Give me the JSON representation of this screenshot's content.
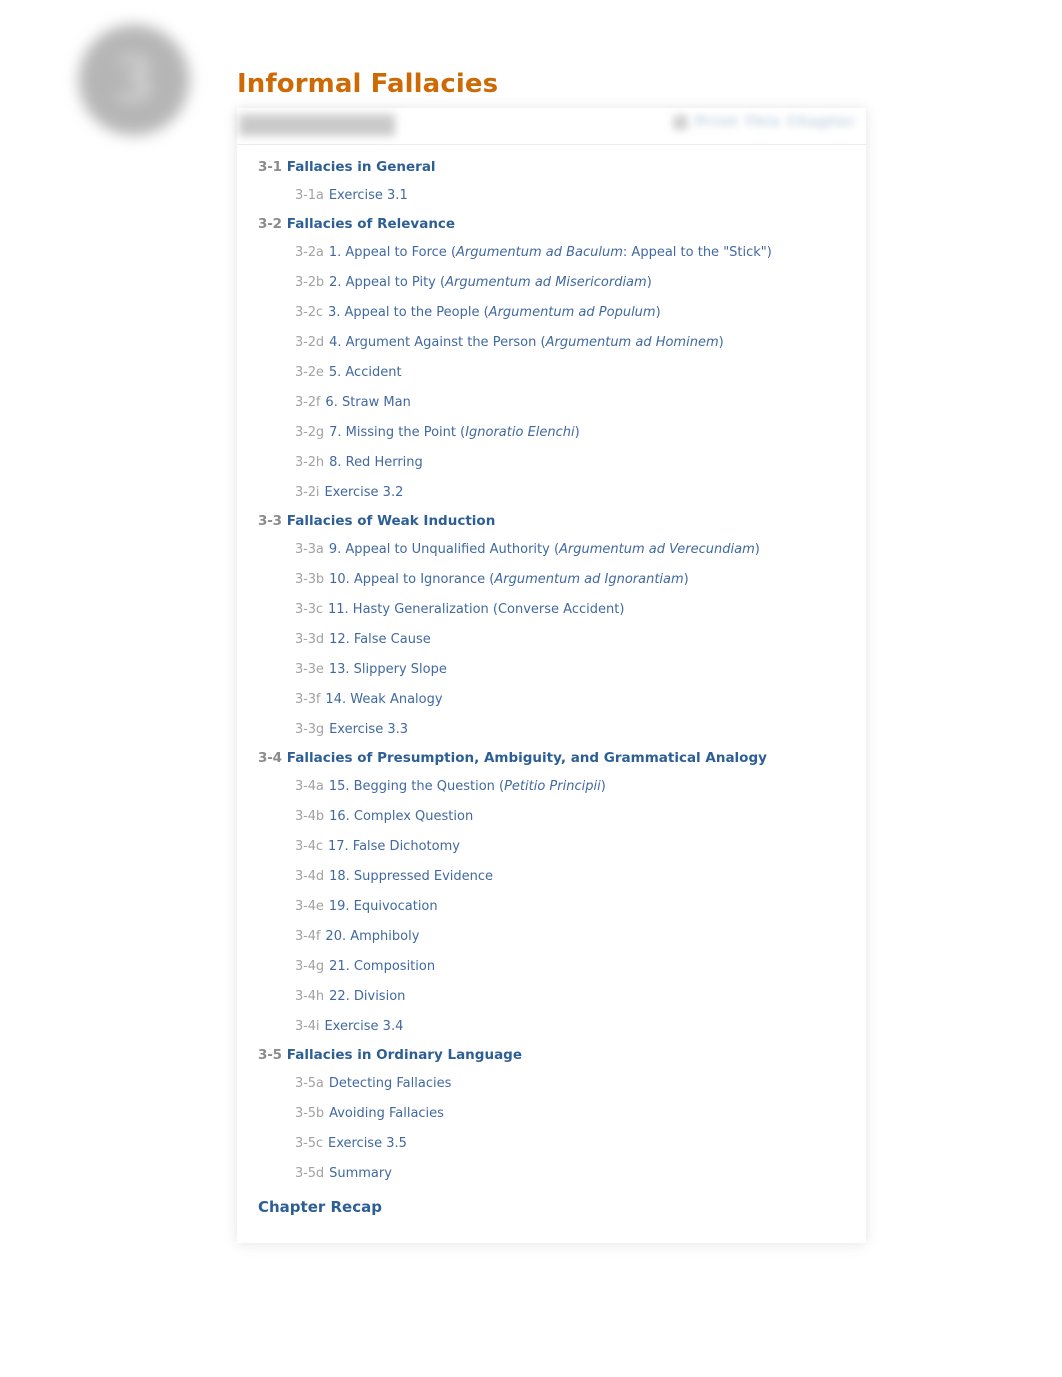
{
  "chapter": {
    "badge_number": "3",
    "title": "Informal Fallacies",
    "title_color": "#cd6a06"
  },
  "toc_header": {
    "tab_label": "Chapter Contents",
    "action_icon": "printer-icon",
    "action_label": "Print This Chapter",
    "blurred": true
  },
  "colors": {
    "section_number": "#8c8c8c",
    "section_title": "#2e5f94",
    "item_number": "#a2a2a2",
    "item_title": "#41699f",
    "accent_orange": "#cd6a06"
  },
  "contents": {
    "sections": [
      {
        "number": "3-1",
        "title": "Fallacies in General",
        "items": [
          {
            "number": "3-1a",
            "title": "Exercise 3.1"
          }
        ]
      },
      {
        "number": "3-2",
        "title": "Fallacies of Relevance",
        "items": [
          {
            "number": "3-2a",
            "title": "1. Appeal to Force (",
            "italic": "Argumentum ad Baculum",
            "title_after": ": Appeal to the \"Stick\")"
          },
          {
            "number": "3-2b",
            "title": "2. Appeal to Pity (",
            "italic": "Argumentum ad Misericordiam",
            "title_after": ")"
          },
          {
            "number": "3-2c",
            "title": "3. Appeal to the People (",
            "italic": "Argumentum ad Populum",
            "title_after": ")"
          },
          {
            "number": "3-2d",
            "title": "4. Argument Against the Person (",
            "italic": "Argumentum ad Hominem",
            "title_after": ")"
          },
          {
            "number": "3-2e",
            "title": "5. Accident"
          },
          {
            "number": "3-2f",
            "title": "6. Straw Man"
          },
          {
            "number": "3-2g",
            "title": "7. Missing the Point (",
            "italic": "Ignoratio Elenchi",
            "title_after": ")"
          },
          {
            "number": "3-2h",
            "title": "8. Red Herring"
          },
          {
            "number": "3-2i",
            "title": "Exercise 3.2"
          }
        ]
      },
      {
        "number": "3-3",
        "title": "Fallacies of Weak Induction",
        "items": [
          {
            "number": "3-3a",
            "title": "9. Appeal to Unqualified Authority (",
            "italic": "Argumentum ad Verecundiam",
            "title_after": ")"
          },
          {
            "number": "3-3b",
            "title": "10. Appeal to Ignorance (",
            "italic": "Argumentum ad Ignorantiam",
            "title_after": ")"
          },
          {
            "number": "3-3c",
            "title": "11. Hasty Generalization (Converse Accident)"
          },
          {
            "number": "3-3d",
            "title": "12. False Cause"
          },
          {
            "number": "3-3e",
            "title": "13. Slippery Slope"
          },
          {
            "number": "3-3f",
            "title": "14. Weak Analogy"
          },
          {
            "number": "3-3g",
            "title": "Exercise 3.3"
          }
        ]
      },
      {
        "number": "3-4",
        "title": "Fallacies of Presumption, Ambiguity, and Grammatical Analogy",
        "items": [
          {
            "number": "3-4a",
            "title": "15. Begging the Question (",
            "italic": "Petitio Principii",
            "title_after": ")"
          },
          {
            "number": "3-4b",
            "title": "16. Complex Question"
          },
          {
            "number": "3-4c",
            "title": "17. False Dichotomy"
          },
          {
            "number": "3-4d",
            "title": "18. Suppressed Evidence"
          },
          {
            "number": "3-4e",
            "title": "19. Equivocation"
          },
          {
            "number": "3-4f",
            "title": "20. Amphiboly"
          },
          {
            "number": "3-4g",
            "title": "21. Composition"
          },
          {
            "number": "3-4h",
            "title": "22. Division"
          },
          {
            "number": "3-4i",
            "title": "Exercise 3.4"
          }
        ]
      },
      {
        "number": "3-5",
        "title": "Fallacies in Ordinary Language",
        "items": [
          {
            "number": "3-5a",
            "title": "Detecting Fallacies"
          },
          {
            "number": "3-5b",
            "title": "Avoiding Fallacies"
          },
          {
            "number": "3-5c",
            "title": "Exercise 3.5"
          },
          {
            "number": "3-5d",
            "title": "Summary"
          }
        ]
      }
    ],
    "recap_label": "Chapter Recap"
  }
}
